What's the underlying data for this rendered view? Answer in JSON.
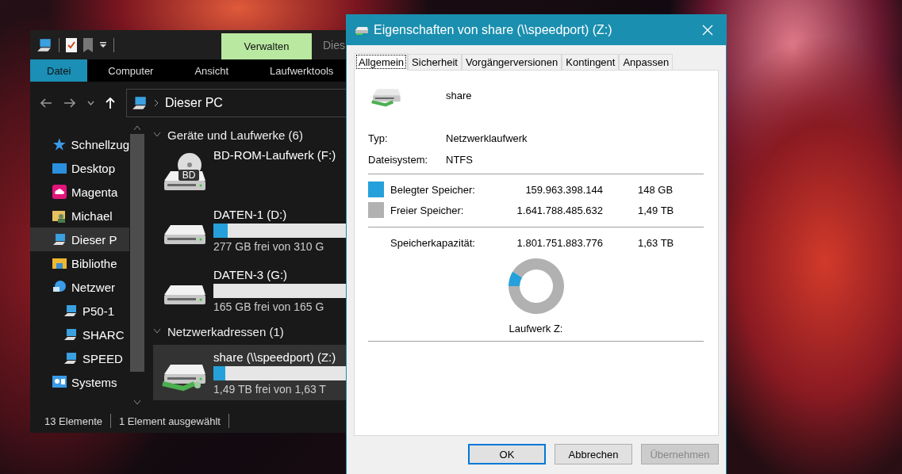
{
  "explorer": {
    "title_fragment": "Dies",
    "context_tab": "Verwalten",
    "ribbon_tabs": [
      {
        "label": "Datei",
        "selected": true
      },
      {
        "label": "Computer",
        "selected": false
      },
      {
        "label": "Ansicht",
        "selected": false
      },
      {
        "label": "Laufwerktools",
        "selected": false
      }
    ],
    "address": "Dieser PC",
    "nav_items": [
      {
        "kind": "star",
        "label": "Schnellzug",
        "selected": false
      },
      {
        "kind": "desktop",
        "label": "Desktop",
        "selected": false
      },
      {
        "kind": "cloud",
        "label": "Magenta",
        "selected": false
      },
      {
        "kind": "user",
        "label": "Michael",
        "selected": false
      },
      {
        "kind": "pc",
        "label": "Dieser P",
        "selected": true
      },
      {
        "kind": "library",
        "label": "Bibliothe",
        "selected": false
      },
      {
        "kind": "network",
        "label": "Netzwer",
        "selected": false,
        "children": [
          {
            "kind": "pc",
            "label": "P50-1",
            "selected": false
          },
          {
            "kind": "pc",
            "label": "SHARC",
            "selected": false
          },
          {
            "kind": "pc",
            "label": "SPEED",
            "selected": false
          }
        ]
      },
      {
        "kind": "system",
        "label": "Systems",
        "selected": false
      }
    ],
    "groups": [
      {
        "title": "Geräte und Laufwerke (6)",
        "expanded": true,
        "items": [
          {
            "kind": "optical",
            "name": "BD-ROM-Laufwerk (F:)",
            "badge": "BD",
            "selected": false
          },
          {
            "kind": "disk",
            "name": "DATEN-1 (D:)",
            "level": 0.106,
            "free": "277 GB frei von 310 G",
            "selected": false
          },
          {
            "kind": "disk",
            "name": "DATEN-3 (G:)",
            "level": 0,
            "free": "165 GB frei von 165 G",
            "selected": false
          }
        ]
      },
      {
        "title": "Netzwerkadressen (1)",
        "expanded": true,
        "items": [
          {
            "kind": "netdisk",
            "name": "share (\\\\speedport) (Z:)",
            "level": 0.09,
            "free": "1,49 TB frei von 1,63 T",
            "selected": true
          }
        ]
      }
    ],
    "status": [
      "13 Elemente",
      "1 Element ausgewählt"
    ]
  },
  "dialog": {
    "title": "Eigenschaften von share (\\\\speedport) (Z:)",
    "tabs": [
      {
        "label": "Allgemein",
        "selected": true
      },
      {
        "label": "Sicherheit",
        "selected": false
      },
      {
        "label": "Vorgängerversionen",
        "selected": false
      },
      {
        "label": "Kontingent",
        "selected": false
      },
      {
        "label": "Anpassen",
        "selected": false
      }
    ],
    "name": "share",
    "properties": [
      {
        "label": "Typ:",
        "value": "Netzwerklaufwerk"
      },
      {
        "label": "Dateisystem:",
        "value": "NTFS"
      }
    ],
    "usage": [
      {
        "label": "Belegter Speicher:",
        "bytes": "159.963.398.144",
        "size": "148 GB",
        "color": "#26a0da"
      },
      {
        "label": "Freier Speicher:",
        "bytes": "1.641.788.485.632",
        "size": "1,49 TB",
        "color": "#b1b1b1"
      }
    ],
    "capacity": {
      "label": "Speicherkapazität:",
      "bytes": "1.801.751.883.776",
      "size": "1,63 TB"
    },
    "chart_data": {
      "type": "donut",
      "values": [
        8.88,
        91.12
      ]
    },
    "drive_label": "Laufwerk Z:",
    "buttons": [
      {
        "label": "OK",
        "default": true,
        "disabled": false
      },
      {
        "label": "Abbrechen",
        "default": false,
        "disabled": false
      },
      {
        "label": "Übernehmen",
        "default": false,
        "disabled": true
      }
    ]
  }
}
